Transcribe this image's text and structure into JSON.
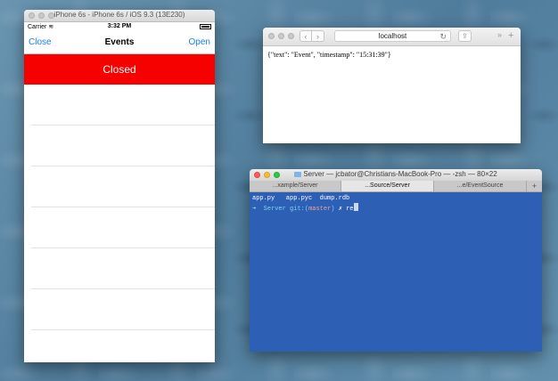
{
  "simulator": {
    "window_title": "iPhone 6s - iPhone 6s / iOS 9.3 (13E230)",
    "status_bar": {
      "carrier": "Carrier",
      "time": "3:32 PM"
    },
    "nav": {
      "left": "Close",
      "title": "Events",
      "right": "Open"
    },
    "banner": {
      "text": "Closed",
      "color": "#f60000"
    }
  },
  "safari": {
    "url": "localhost",
    "content": "{\"text\": \"Event\", \"timestamp\": \"15:31:39\"}"
  },
  "terminal": {
    "title": "Server — jcbator@Christians-MacBook-Pro — -zsh — 80×22",
    "tabs": [
      {
        "label": "...xample/Server"
      },
      {
        "label": "...Source/Server"
      },
      {
        "label": "...e/EventSource"
      }
    ],
    "active_tab": 1,
    "ls_output": "app.py   app.pyc  dump.rdb",
    "prompt": {
      "dir": "Server",
      "git_prefix": "git:(",
      "branch": "master",
      "git_suffix": ")",
      "dirty": "✗",
      "command": "re"
    }
  }
}
